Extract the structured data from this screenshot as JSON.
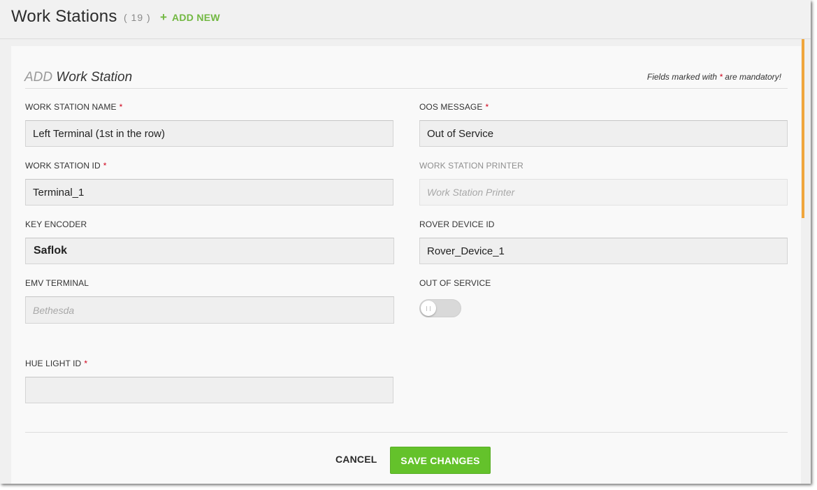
{
  "header": {
    "title": "Work Stations",
    "count": "( 19 )",
    "add_new_icon": "plus-icon",
    "add_new_label": "ADD NEW"
  },
  "form": {
    "heading_verb": "ADD",
    "heading_noun": "Work Station",
    "mandatory_prefix": "Fields marked with",
    "mandatory_star": "*",
    "mandatory_suffix": "are mandatory!",
    "required_marker": "*",
    "fields": {
      "work_station_name": {
        "label": "WORK STATION NAME",
        "value": "Left Terminal (1st in the row)"
      },
      "oos_message": {
        "label": "OOS MESSAGE",
        "value": "Out of Service"
      },
      "work_station_id": {
        "label": "WORK STATION ID",
        "value": "Terminal_1"
      },
      "work_station_printer": {
        "label": "WORK STATION PRINTER",
        "placeholder": "Work Station Printer"
      },
      "key_encoder": {
        "label": "KEY ENCODER",
        "value": "Saflok"
      },
      "rover_device_id": {
        "label": "ROVER DEVICE ID",
        "value": "Rover_Device_1"
      },
      "emv_terminal": {
        "label": "EMV TERMINAL",
        "placeholder": "Bethesda"
      },
      "out_of_service": {
        "label": "OUT OF SERVICE",
        "enabled": false
      },
      "hue_light_id": {
        "label": "HUE LIGHT ID",
        "value": ""
      }
    }
  },
  "actions": {
    "cancel_label": "CANCEL",
    "save_label": "SAVE CHANGES"
  },
  "colors": {
    "accent_green": "#72b842",
    "save_button": "#64c22b",
    "required_red": "#d0021b",
    "scroll_accent": "#f0a63b"
  }
}
